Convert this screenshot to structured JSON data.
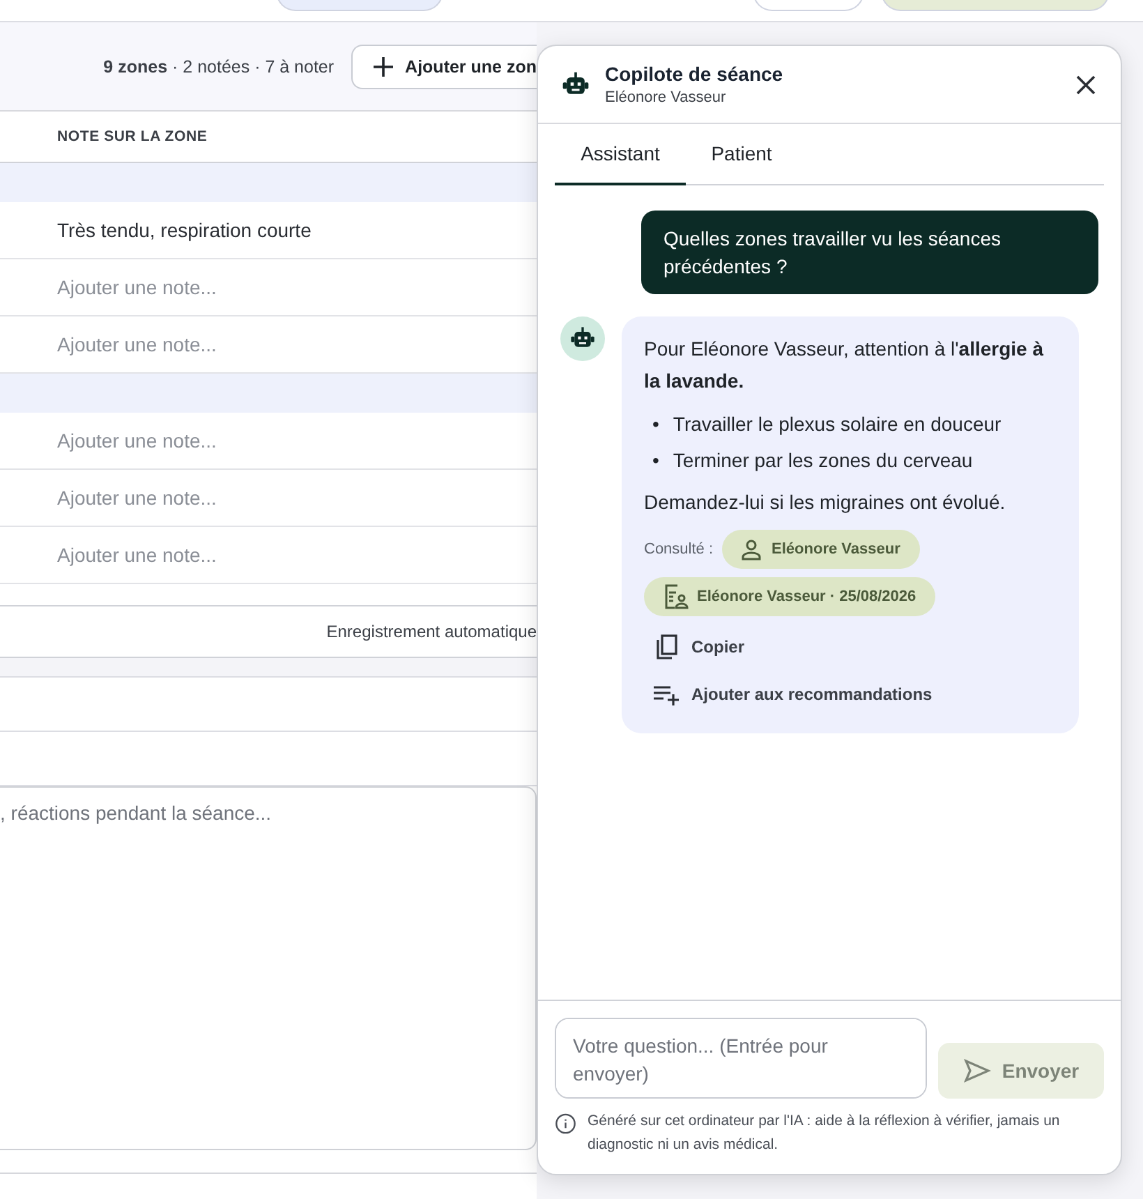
{
  "toolbar": {
    "summary": "**9 zones** · 2 notées · 7 à noter",
    "add_button": "Ajouter une zon"
  },
  "table": {
    "columns": [
      "NOTE SUR LA ZONE"
    ],
    "rows": [
      {
        "kind": "group"
      },
      {
        "kind": "note",
        "value": "Très tendu, respiration courte"
      },
      {
        "kind": "note",
        "placeholder": "Ajouter une note..."
      },
      {
        "kind": "note",
        "placeholder": "Ajouter une note..."
      },
      {
        "kind": "group"
      },
      {
        "kind": "note",
        "placeholder": "Ajouter une note..."
      },
      {
        "kind": "note",
        "placeholder": "Ajouter une note..."
      },
      {
        "kind": "note",
        "placeholder": "Ajouter une note..."
      }
    ],
    "footer": "Enregistrement automatique"
  },
  "session_notes": {
    "placeholder": ", réactions pendant la séance..."
  },
  "copilot": {
    "title": "Copilote de séance",
    "subtitle": "Eléonore Vasseur",
    "tabs": [
      {
        "label": "Assistant",
        "selected": true
      },
      {
        "label": "Patient",
        "selected": false
      }
    ],
    "messages": [
      {
        "kind": "user",
        "text": "Quelles zones travailler vu les séances précédentes ?"
      },
      {
        "kind": "assistant",
        "intro": "Pour Eléonore Vasseur, attention à l'**allergie à la lavande.**",
        "bullets": [
          {
            "marker": "•",
            "text": "Travailler le plexus solaire en douceur"
          },
          {
            "marker": "•",
            "text": "Terminer par les zones du cerveau"
          }
        ],
        "outro": "Demandez-lui si les migraines ont évolué.",
        "sources_label": "Consulté :",
        "sources": [
          {
            "kind": "patient",
            "label": "Eléonore Vasseur"
          },
          {
            "kind": "session",
            "label": "Eléonore Vasseur · 25/08/2026"
          }
        ],
        "actions": [
          {
            "kind": "copy",
            "label": "Copier"
          },
          {
            "kind": "add",
            "label": "Ajouter aux recommandations"
          }
        ]
      }
    ],
    "input": {
      "placeholder": "Votre question... (Entrée pour envoyer)"
    },
    "send_button": {
      "label": "Envoyer",
      "disabled": true
    },
    "disclaimer": "Généré sur cet ordinateur par l'IA : aide à la réflexion à vérifier, jamais un diagnostic ni un avis médical."
  }
}
